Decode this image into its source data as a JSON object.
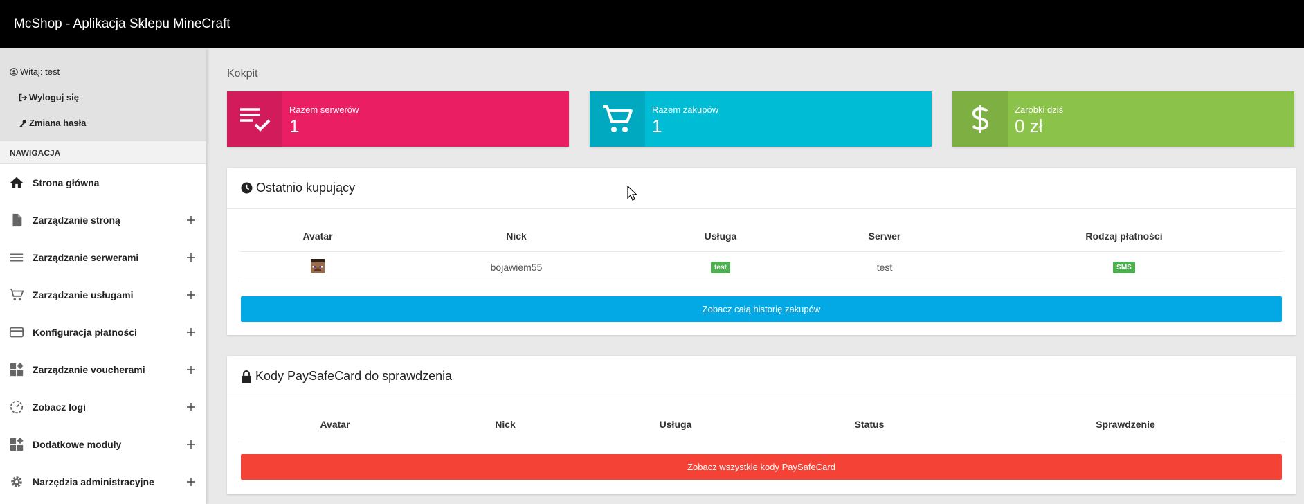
{
  "app": {
    "title": "McShop - Aplikacja Sklepu MineCraft"
  },
  "user": {
    "welcome": "Witaj: test",
    "logout": "Wyloguj się",
    "change_password": "Zmiana hasła"
  },
  "nav": {
    "header": "NAWIGACJA",
    "items": [
      {
        "label": "Strona główna",
        "icon": "home-icon"
      },
      {
        "label": "Zarządzanie stroną",
        "icon": "document-icon"
      },
      {
        "label": "Zarządzanie serwerami",
        "icon": "menu-lines-icon"
      },
      {
        "label": "Zarządzanie usługami",
        "icon": "cart-icon"
      },
      {
        "label": "Konfiguracja płatności",
        "icon": "credit-card-icon"
      },
      {
        "label": "Zarządzanie voucherami",
        "icon": "widgets-icon"
      },
      {
        "label": "Zobacz logi",
        "icon": "gauge-icon"
      },
      {
        "label": "Dodatkowe moduły",
        "icon": "widgets-icon"
      },
      {
        "label": "Narzędzia administracyjne",
        "icon": "gear-icon"
      }
    ]
  },
  "breadcrumb": "Kokpit",
  "stats": [
    {
      "label": "Razem serwerów",
      "value": "1",
      "icon": "playlist-check-icon",
      "color": "#e91e63"
    },
    {
      "label": "Razem zakupów",
      "value": "1",
      "icon": "cart-icon",
      "color": "#00bcd4"
    },
    {
      "label": "Zarobki dziś",
      "value": "0 zł",
      "icon": "dollar-icon",
      "color": "#8bc34a"
    }
  ],
  "recent": {
    "title": "Ostatnio kupujący",
    "columns": [
      "Avatar",
      "Nick",
      "Usługa",
      "Serwer",
      "Rodzaj płatności"
    ],
    "rows": [
      {
        "nick": "bojawiem55",
        "service": "test",
        "server": "test",
        "payment": "SMS"
      }
    ],
    "button": "Zobacz całą historię zakupów"
  },
  "psc": {
    "title": "Kody PaySafeCard do sprawdzenia",
    "columns": [
      "Avatar",
      "Nick",
      "Usługa",
      "Status",
      "Sprawdzenie"
    ],
    "button": "Zobacz wszystkie kody PaySafeCard"
  }
}
